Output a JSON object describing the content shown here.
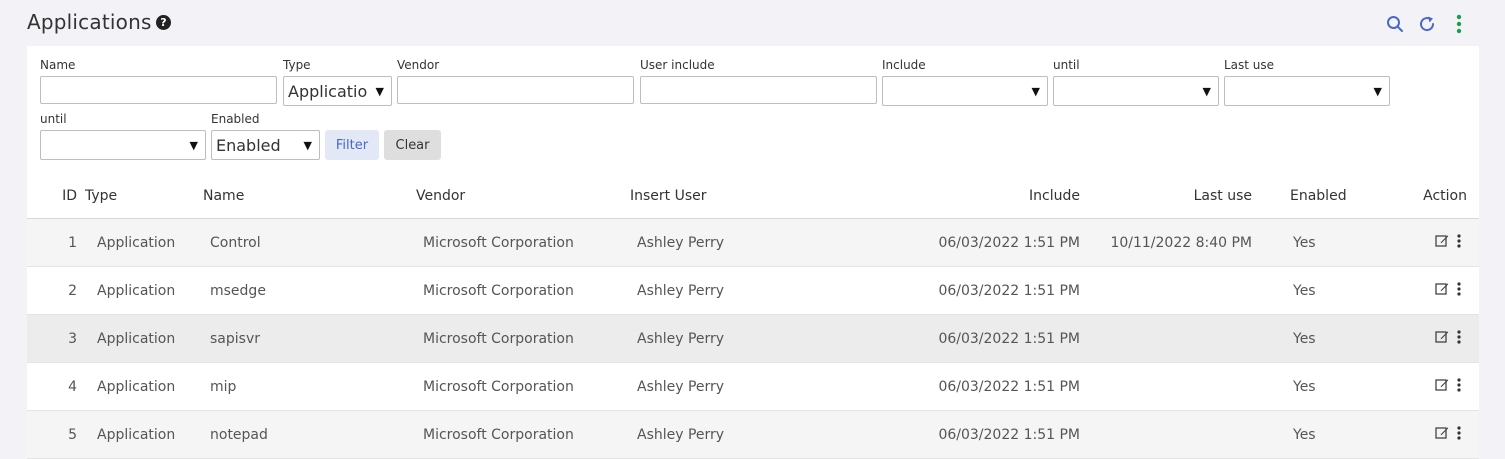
{
  "header": {
    "title": "Applications",
    "help_icon": "question-circle-icon",
    "icons": [
      "search-icon",
      "refresh-icon",
      "more-vert-icon"
    ],
    "accent_color": "#4a68c9"
  },
  "filters": {
    "name_label": "Name",
    "name_value": "",
    "type_label": "Type",
    "type_value": "Applicatio",
    "vendor_label": "Vendor",
    "vendor_value": "",
    "user_include_label": "User include",
    "user_include_value": "",
    "include_label": "Include",
    "include_value": "",
    "until1_label": "until",
    "until1_value": "",
    "last_use_label": "Last use",
    "last_use_value": "",
    "until2_label": "until",
    "until2_value": "",
    "enabled_label": "Enabled",
    "enabled_value": "Enabled",
    "filter_button": "Filter",
    "clear_button": "Clear"
  },
  "table": {
    "columns": [
      "ID",
      "Type",
      "Name",
      "Vendor",
      "Insert User",
      "Include",
      "Last use",
      "Enabled",
      "Action"
    ],
    "rows": [
      {
        "id": "1",
        "type": "Application",
        "name": "Control",
        "vendor": "Microsoft Corporation",
        "user": "Ashley Perry",
        "include": "06/03/2022 1:51 PM",
        "last_use": "10/11/2022 8:40 PM",
        "enabled": "Yes"
      },
      {
        "id": "2",
        "type": "Application",
        "name": "msedge",
        "vendor": "Microsoft Corporation",
        "user": "Ashley Perry",
        "include": "06/03/2022 1:51 PM",
        "last_use": "",
        "enabled": "Yes"
      },
      {
        "id": "3",
        "type": "Application",
        "name": "sapisvr",
        "vendor": "Microsoft Corporation",
        "user": "Ashley Perry",
        "include": "06/03/2022 1:51 PM",
        "last_use": "",
        "enabled": "Yes"
      },
      {
        "id": "4",
        "type": "Application",
        "name": "mip",
        "vendor": "Microsoft Corporation",
        "user": "Ashley Perry",
        "include": "06/03/2022 1:51 PM",
        "last_use": "",
        "enabled": "Yes"
      },
      {
        "id": "5",
        "type": "Application",
        "name": "notepad",
        "vendor": "Microsoft Corporation",
        "user": "Ashley Perry",
        "include": "06/03/2022 1:51 PM",
        "last_use": "",
        "enabled": "Yes"
      }
    ],
    "row_action_icons": [
      "edit-icon",
      "more-vert-icon"
    ]
  }
}
